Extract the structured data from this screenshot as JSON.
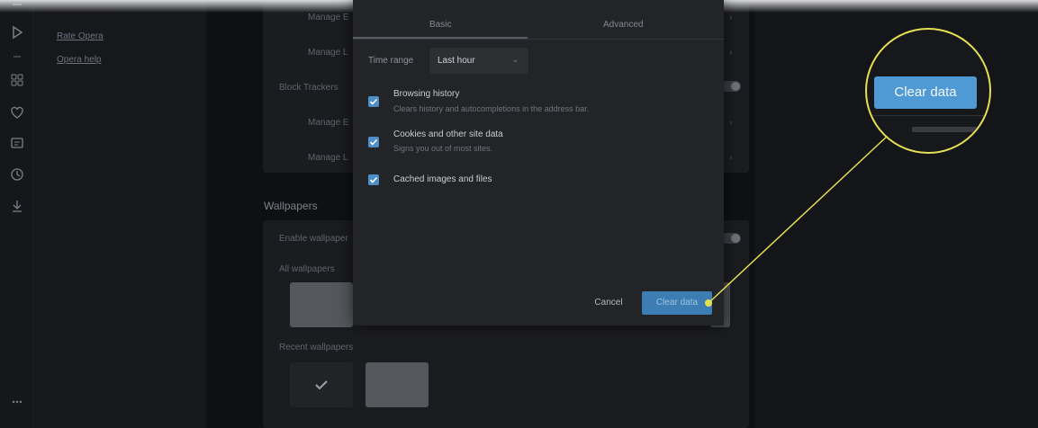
{
  "sidenav": {
    "links": [
      "Rate Opera",
      "Opera help"
    ]
  },
  "settings": {
    "rows": [
      "Manage E",
      "Manage L",
      "Block Trackers",
      "Manage E",
      "Manage L"
    ],
    "wallpapers_title": "Wallpapers",
    "enable_wallpapers": "Enable wallpaper",
    "all_wallpapers": "All wallpapers",
    "recent_wallpapers": "Recent wallpapers"
  },
  "dialog": {
    "tabs": [
      "Basic",
      "Advanced"
    ],
    "time_range_label": "Time range",
    "time_range_value": "Last hour",
    "options": [
      {
        "title": "Browsing history",
        "desc": "Clears history and autocompletions in the address bar.",
        "checked": true
      },
      {
        "title": "Cookies and other site data",
        "desc": "Signs you out of most sites.",
        "checked": true
      },
      {
        "title": "Cached images and files",
        "desc": "",
        "checked": true
      }
    ],
    "cancel_label": "Cancel",
    "clear_label": "Clear data"
  },
  "callout": {
    "clear_label": "Clear data",
    "highlight_color": "#e4e053"
  },
  "colors": {
    "accent": "#4f9ad5",
    "checkbox": "#4d8fc6"
  }
}
